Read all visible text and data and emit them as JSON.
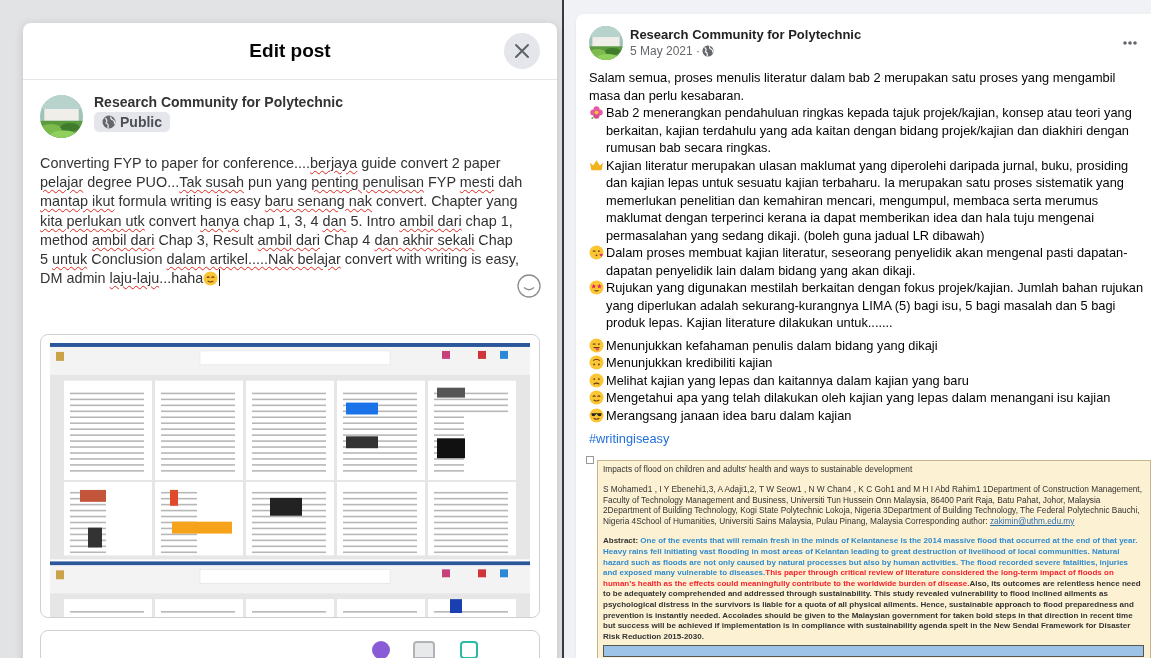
{
  "edit_dialog": {
    "title": "Edit post",
    "author": "Research Community for Polytechnic",
    "audience": "Public",
    "text_segments": [
      {
        "text": "Converting FYP to paper for conference....",
        "misspelled": false
      },
      {
        "text": "berjaya",
        "misspelled": true
      },
      {
        "text": " guide convert 2 paper ",
        "misspelled": false
      },
      {
        "text": "pelajar",
        "misspelled": true
      },
      {
        "text": " degree PUO...",
        "misspelled": false
      },
      {
        "text": "Tak susah",
        "misspelled": true
      },
      {
        "text": " pun yang ",
        "misspelled": false
      },
      {
        "text": "penting penulisan",
        "misspelled": true
      },
      {
        "text": " FYP ",
        "misspelled": false
      },
      {
        "text": "mesti",
        "misspelled": true
      },
      {
        "text": " dah ",
        "misspelled": false
      },
      {
        "text": "mantap ikut",
        "misspelled": true
      },
      {
        "text": " formula writing is easy ",
        "misspelled": false
      },
      {
        "text": "baru senang nak",
        "misspelled": true
      },
      {
        "text": " convert. Chapter yang ",
        "misspelled": false
      },
      {
        "text": "kita perlukan utk",
        "misspelled": true
      },
      {
        "text": " convert ",
        "misspelled": false
      },
      {
        "text": "hanya",
        "misspelled": true
      },
      {
        "text": " chap 1, 3, 4 ",
        "misspelled": false
      },
      {
        "text": "dan",
        "misspelled": true
      },
      {
        "text": " 5. Intro ",
        "misspelled": false
      },
      {
        "text": "ambil dari",
        "misspelled": true
      },
      {
        "text": " chap 1, method ",
        "misspelled": false
      },
      {
        "text": "ambil dari",
        "misspelled": true
      },
      {
        "text": " Chap 3, Result ",
        "misspelled": false
      },
      {
        "text": "ambil dari",
        "misspelled": true
      },
      {
        "text": " Chap 4 ",
        "misspelled": false
      },
      {
        "text": "dan akhir sekali",
        "misspelled": true
      },
      {
        "text": " Chap 5 ",
        "misspelled": false
      },
      {
        "text": "untuk",
        "misspelled": true
      },
      {
        "text": " Conclusion ",
        "misspelled": false
      },
      {
        "text": "dalam artikel.....Nak belajar",
        "misspelled": true
      },
      {
        "text": " convert with writing is easy, DM admin ",
        "misspelled": false
      },
      {
        "text": "laju-laju",
        "misspelled": true
      },
      {
        "text": "...haha",
        "misspelled": false
      }
    ]
  },
  "post": {
    "author": "Research Community for Polytechnic",
    "date": "5 May 2021 ·",
    "paragraphs": [
      {
        "kind": "plain",
        "text": "Salam semua, proses menulis literatur dalam bab 2 merupakan satu proses yang mengambil masa dan perlu kesabaran."
      },
      {
        "kind": "flower",
        "text": "Bab 2 menerangkan pendahuluan ringkas kepada tajuk projek/kajian, konsep atau teori yang berkaitan, kajian terdahulu yang ada kaitan dengan bidang projek/kajian dan diakhiri dengan rumusan bab secara ringkas."
      },
      {
        "kind": "crown",
        "text": "Kajian literatur merupakan ulasan maklumat yang diperolehi daripada jurnal, buku, prosiding dan kajian lepas untuk sesuatu kajian terbaharu. Ia merupakan satu proses sistematik yang memerlukan penelitian dan kemahiran mencari, mengumpul, membaca serta merumus maklumat dengan terperinci kerana ia dapat memberikan idea dan hala tuju mengenai permasalahan yang sedang dikaji. (boleh guna jadual LR dibawah)"
      },
      {
        "kind": "kiss",
        "text": "Dalam proses membuat kajian literatur, seseorang penyelidik akan mengenal pasti dapatan-dapatan penyelidik lain dalam bidang yang akan dikaji."
      },
      {
        "kind": "star_eyes",
        "text": "Rujukan yang digunakan mestilah berkaitan dengan fokus projek/kajian. Jumlah bahan rujukan yang diperlukan adalah sekurang-kurangnya LIMA (5) bagi isu, 5 bagi masalah dan 5 bagi produk lepas. Kajian literature dilakukan untuk......."
      }
    ],
    "list_items": [
      {
        "kind": "tongue",
        "text": "Menunjukkan kefahaman penulis dalam bidang yang dikaji"
      },
      {
        "kind": "upside_down",
        "text": "Menunjukkan kredibiliti kajian"
      },
      {
        "kind": "worried",
        "text": "Melihat kajian yang lepas dan kaitannya dalam kajian yang baru"
      },
      {
        "kind": "relieved",
        "text": "Mengetahui apa yang telah dilakukan oleh kajian yang lepas dalam menangani isu kajian"
      },
      {
        "kind": "sunglasses",
        "text": "Merangsang janaan idea baru dalam kajian"
      }
    ],
    "hashtag": "#writingiseasy",
    "document": {
      "title": "Impacts of flood on children and adults' health and ways to sustainable development",
      "authors": "S Mohamed1 , I Y Ebenehi1,3, A Adaji1,2, T W Seow1 , N W Chan4 , K C Goh1 and M H I Abd Rahim1 1Department of Construction Management, Faculty of Technology Management and Business, Universiti Tun Hussein Onn Malaysia, 86400 Parit Raja, Batu Pahat, Johor, Malaysia 2Department of Building Technology, Kogi State Polytechnic Lokoja, Nigeria 3Department of Building Technology, The Federal Polytechnic Bauchi, Nigeria 4School of Humanities, Universiti Sains Malaysia, Pulau Pinang, Malaysia Corresponding author:",
      "email": "zakimin@uthm.edu.my",
      "abstract_label": "Abstract:",
      "abstract_parts": [
        {
          "color": "#2f8ccf",
          "text": "One of the events that will remain fresh in the minds of Kelantanese is the 2014 massive flood that occurred at the end of that year. Heavy rains fell initiating vast flooding in most areas of Kelantan leading to great destruction of livelihood of local communities. Natural hazard such as floods are not only caused by natural processes but also by human activities. The flood recorded severe fatalities, injuries and exposed many vulnerable to diseases."
        },
        {
          "color": "#f5222d",
          "text": "This paper through critical review of literature considered the long-term impact of floods on human’s health as the effects could meaningfully contribute to the worldwide burden of disease."
        },
        {
          "color": "#333333",
          "text": "Also, its outcomes are relentless hence need to be adequately comprehended and addressed through sustainability. This study revealed vulnerability to flood inclined ailments as psychological distress in the survivors is liable for a quota of all physical ailments. Hence, sustainable approach to flood preparedness and prevention is instantly needed. Accolades should be given to the Malaysian government for taken bold steps in that direction in recent time but success will be achieved if implementation is in compliance with sustainability agenda spelt in the New Sendai Framework for Disaster Risk Reduction 2015-2030."
        }
      ]
    }
  }
}
